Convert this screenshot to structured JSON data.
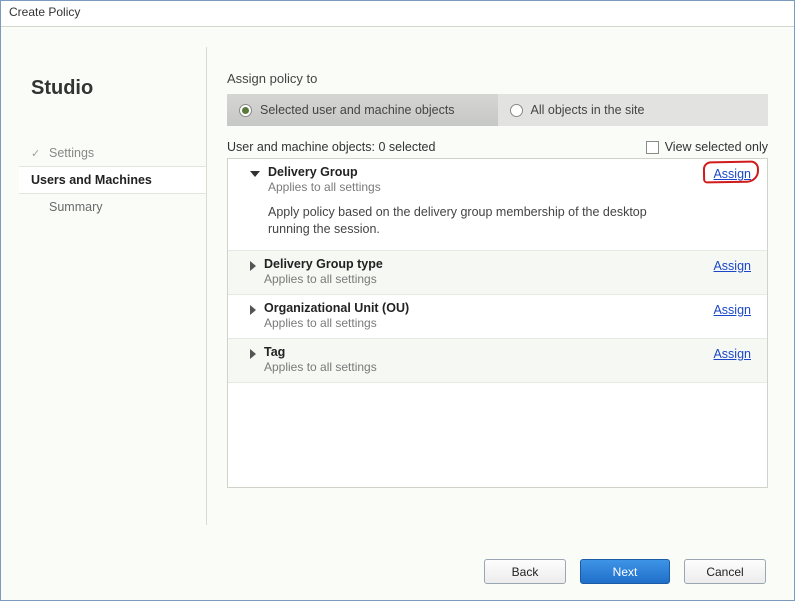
{
  "window": {
    "title": "Create Policy"
  },
  "sidebar": {
    "brand": "Studio",
    "steps": [
      {
        "label": "Settings",
        "state": "done"
      },
      {
        "label": "Users and Machines",
        "state": "current"
      },
      {
        "label": "Summary",
        "state": "upcoming"
      }
    ]
  },
  "main": {
    "assign_label": "Assign policy to",
    "toggle": {
      "selected_label": "Selected user and machine objects",
      "all_label": "All objects in the site"
    },
    "list_header": "User and machine objects: 0 selected",
    "view_selected_only": "View selected only",
    "items": [
      {
        "title": "Delivery Group",
        "subtitle": "Applies to all settings",
        "description": "Apply policy based on the delivery group membership of the desktop running the session.",
        "assign": "Assign",
        "expanded": true,
        "highlighted": true
      },
      {
        "title": "Delivery Group type",
        "subtitle": "Applies to all settings",
        "assign": "Assign",
        "expanded": false
      },
      {
        "title": "Organizational Unit (OU)",
        "subtitle": "Applies to all settings",
        "assign": "Assign",
        "expanded": false
      },
      {
        "title": "Tag",
        "subtitle": "Applies to all settings",
        "assign": "Assign",
        "expanded": false
      }
    ]
  },
  "footer": {
    "back": "Back",
    "next": "Next",
    "cancel": "Cancel"
  }
}
